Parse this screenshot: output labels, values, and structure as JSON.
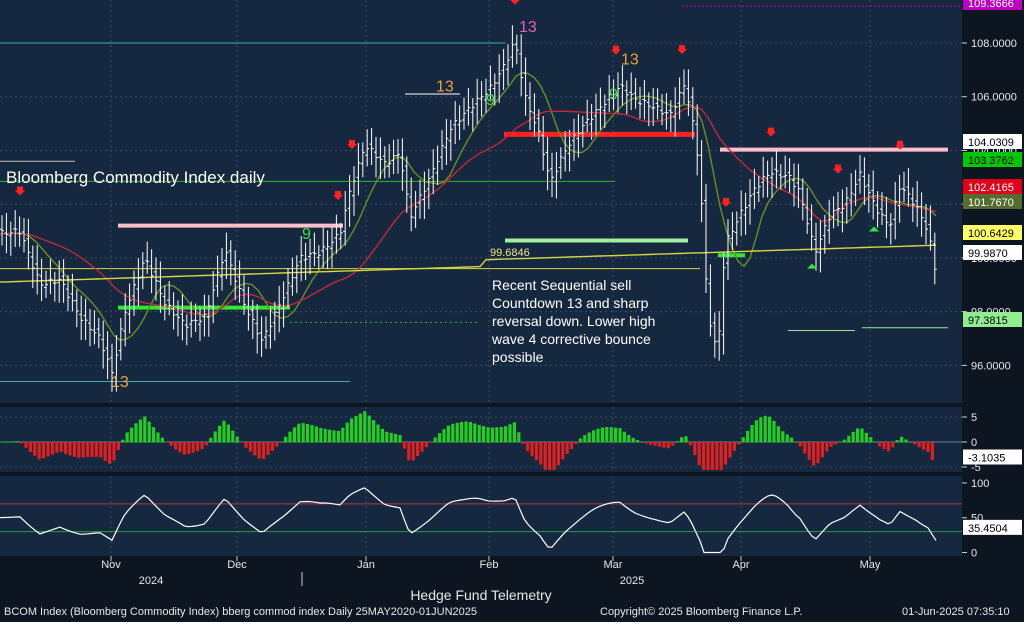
{
  "chart_data": [
    {
      "type": "candlestick",
      "title": "Bloomberg Commodity Index daily",
      "ylim": [
        94.6,
        109.6
      ],
      "yticks": [
        96,
        98,
        100,
        102,
        104,
        106,
        108
      ],
      "ytick_labels": [
        "96.0000",
        "98.0000",
        "100.0000",
        "102.0000",
        "104.0000",
        "106.0000",
        "108.0000"
      ],
      "grid": true,
      "annotation": "Recent Sequential sell Countdown 13 and sharp reversal down.  Lower high wave 4 corrective bounce possible",
      "annotation_lines": [
        "Recent Sequential sell",
        "Countdown 13 and sharp",
        "reversal down.  Lower high",
        "wave 4 corrective bounce",
        "possible"
      ],
      "level_label": "99.6846",
      "right_badges": [
        {
          "label": "109.3666",
          "color": "#c000c0",
          "text_color": "#ffffff",
          "value": 109.37
        },
        {
          "label": "104.0309",
          "color": "#ffffff",
          "text_color": "#000000",
          "value": 104.03
        },
        {
          "label": "103.3762",
          "color": "#00c800",
          "text_color": "#000000",
          "value": 103.38
        },
        {
          "label": "102.4165",
          "color": "#e0001a",
          "text_color": "#ffffff",
          "value": 102.42
        },
        {
          "label": "101.7670",
          "color": "#556b2f",
          "text_color": "#ffffff",
          "value": 101.77
        },
        {
          "label": "100.6429",
          "color": "#ffff66",
          "text_color": "#000000",
          "value": 100.64
        },
        {
          "label": "99.9870",
          "color": "#ffffff",
          "text_color": "#000000",
          "value": 99.99
        },
        {
          "label": "97.3815",
          "color": "#90ee90",
          "text_color": "#000000",
          "value": 97.38
        }
      ],
      "sequential_labels": [
        {
          "text": "13",
          "color": "#f0a040",
          "x_label": "Nov",
          "value": 95.2
        },
        {
          "text": "13",
          "color": "#f0a040",
          "x_label": "Jan",
          "value": 106.2
        },
        {
          "text": "13",
          "color": "#e060c0",
          "x_label": "Feb",
          "value": 108.4
        },
        {
          "text": "9",
          "color": "#40e040",
          "x_label": "Jan",
          "value": 105.7
        },
        {
          "text": "9",
          "color": "#40e040",
          "x_label": "Mar",
          "value": 105.9
        },
        {
          "text": "13",
          "color": "#f0a040",
          "x_label": "Mar",
          "value": 107.2
        },
        {
          "text": "9",
          "color": "#40e040",
          "x_label": "Dec",
          "value": 100.7
        }
      ],
      "colors": {
        "background": "#16283f",
        "bull": "#ffffff",
        "ma_green": "#6b8e23",
        "ma_red": "#c0283a",
        "ma_yellow": "#d8d840",
        "level_pink": "#ffc0cb",
        "level_red": "#ff2020",
        "level_green": "#30e830",
        "level_lightgreen": "#a0f0a0"
      }
    },
    {
      "type": "bar",
      "name": "momentum histogram",
      "ylim": [
        -6,
        7
      ],
      "yticks": [
        5,
        0,
        -5
      ],
      "ytick_labels": [
        "5",
        "0",
        "-5"
      ],
      "last_value_label": "-3.1035",
      "colors": {
        "positive": "#20d020",
        "negative": "#e02020"
      }
    },
    {
      "type": "line",
      "name": "oscillator",
      "ylim": [
        -5,
        110
      ],
      "yticks": [
        100,
        50,
        0
      ],
      "ytick_labels": [
        "100",
        "50",
        "0"
      ],
      "bands": [
        70,
        30
      ],
      "last_value_label": "35.4504",
      "colors": {
        "line": "#ffffff",
        "upper_band": "#c03040",
        "lower_band": "#20a040"
      }
    }
  ],
  "x_axis": {
    "months": [
      "Nov",
      "Dec",
      "Jan",
      "Feb",
      "Mar",
      "Apr",
      "May"
    ],
    "years": [
      "2024",
      "2025"
    ]
  },
  "footer": {
    "title": "Hedge Fund Telemetry",
    "left": "BCOM Index (Bloomberg Commodity Index) bberg commod index  Daily 25MAY2020-01JUN2025",
    "center": "Copyright© 2025 Bloomberg Finance L.P.",
    "right": "01-Jun-2025 07:35:10"
  }
}
